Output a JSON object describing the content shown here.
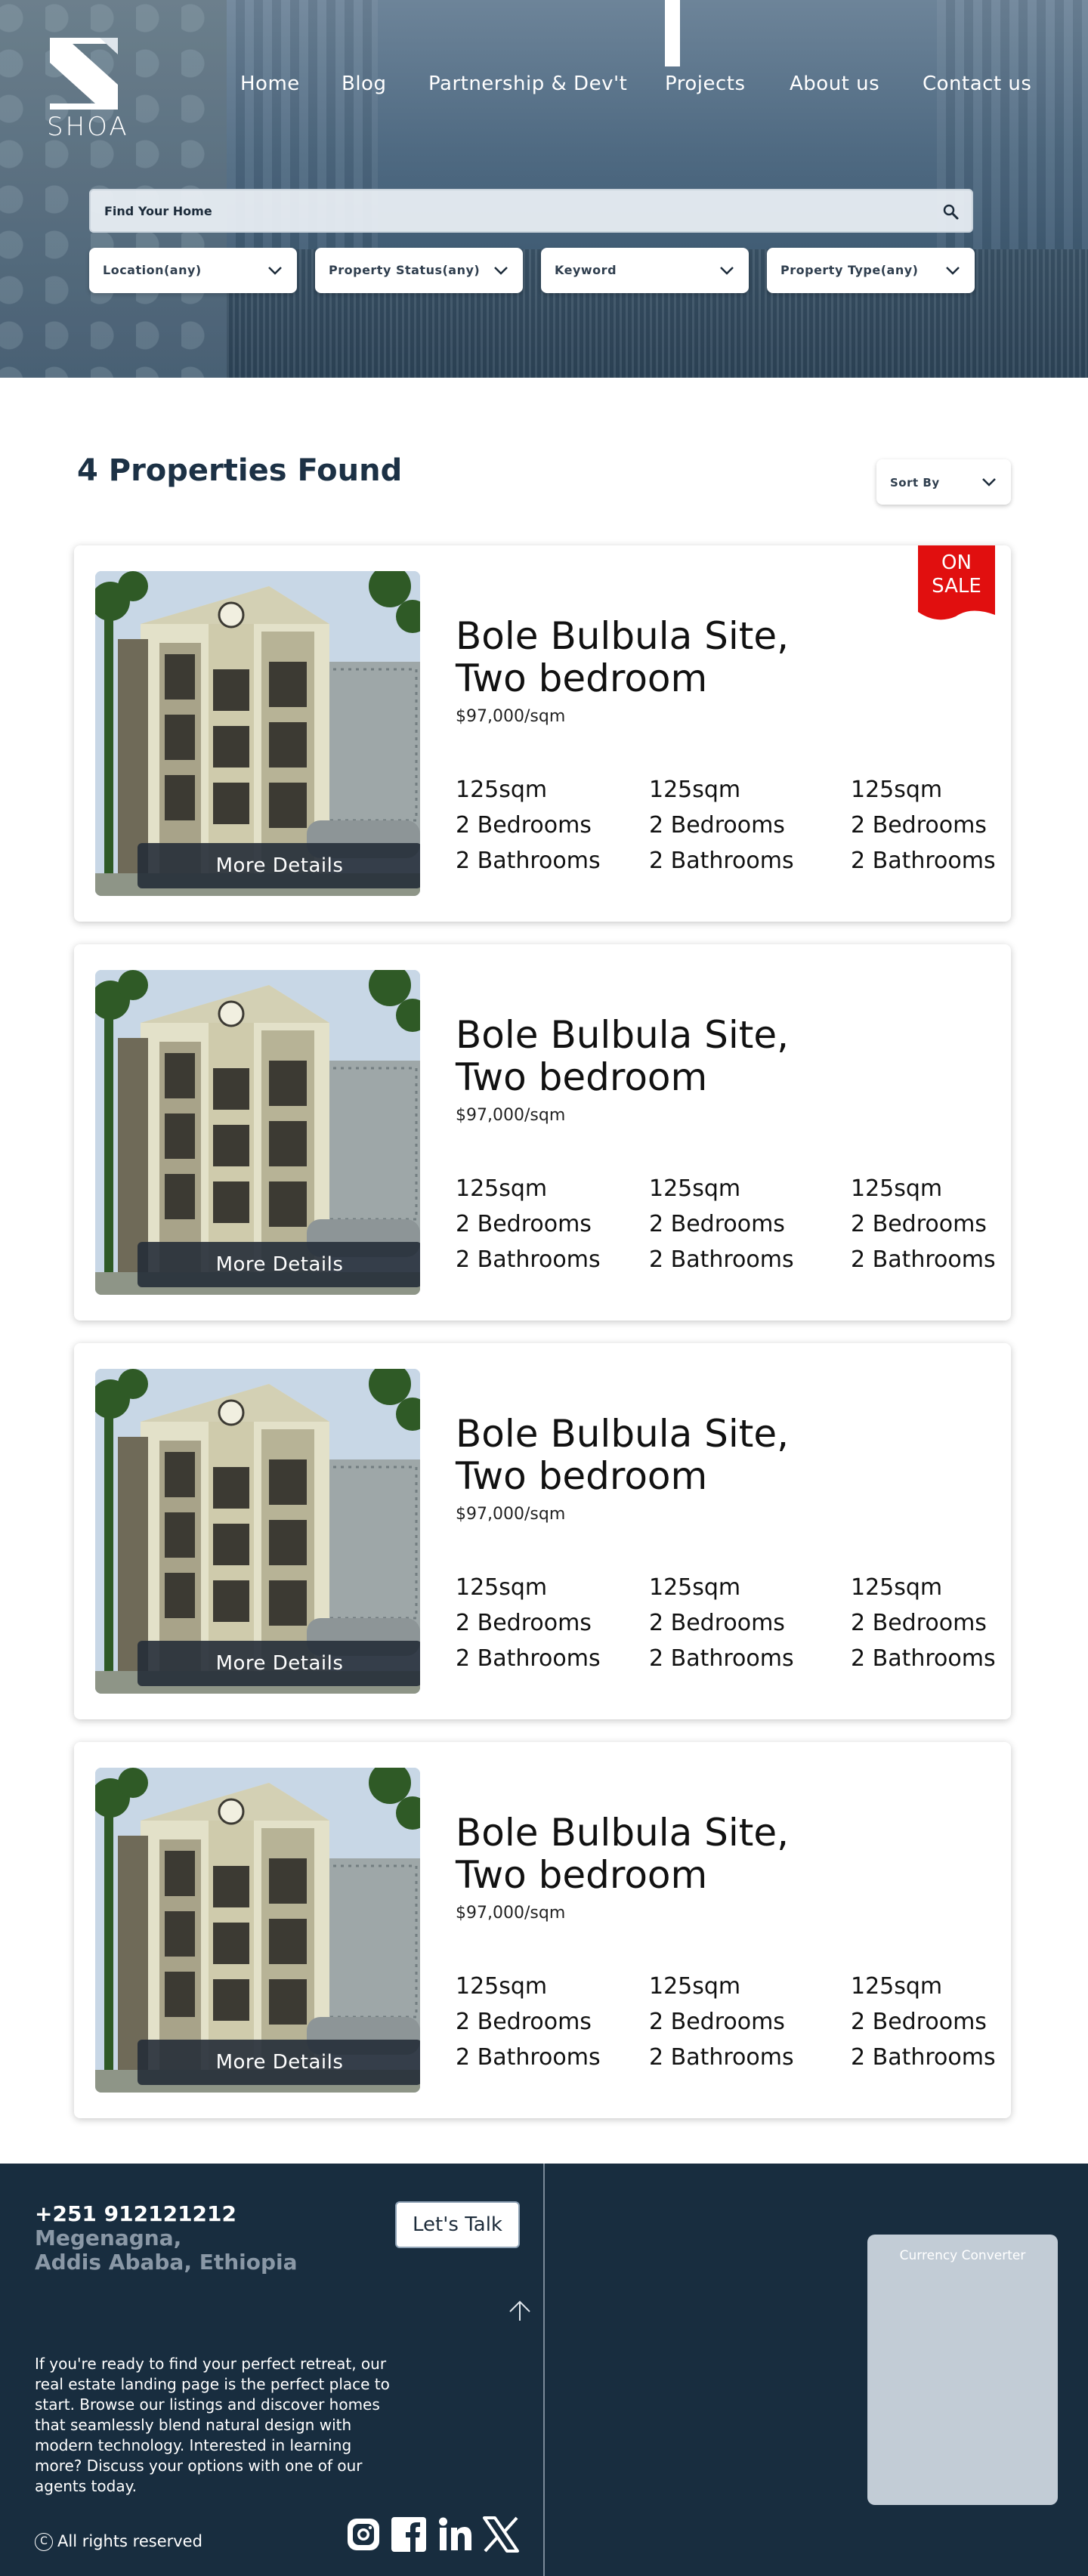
{
  "brand": {
    "logo_text": "SHOA"
  },
  "nav": {
    "items": [
      "Home",
      "Blog",
      "Partnership & Dev't",
      "Projects",
      "About us",
      "Contact us"
    ]
  },
  "search": {
    "placeholder": "Find Your Home",
    "filters": [
      "Location(any)",
      "Property Status(any)",
      "Keyword",
      "Property Type(any)"
    ]
  },
  "results": {
    "count_label": "4 Properties Found",
    "sort_label": "Sort By"
  },
  "listings": [
    {
      "badge": "ON SALE",
      "title_line1": "Bole Bulbula Site,",
      "title_line2": "Two bedroom",
      "price": "$97,000/sqm",
      "cta": "More Details",
      "columns": [
        {
          "area": "125sqm",
          "bedrooms": "2 Bedrooms",
          "bathrooms": "2 Bathrooms"
        },
        {
          "area": "125sqm",
          "bedrooms": "2 Bedrooms",
          "bathrooms": "2 Bathrooms"
        },
        {
          "area": "125sqm",
          "bedrooms": "2 Bedrooms",
          "bathrooms": "2 Bathrooms"
        }
      ]
    },
    {
      "title_line1": "Bole Bulbula Site,",
      "title_line2": "Two bedroom",
      "price": "$97,000/sqm",
      "cta": "More Details",
      "columns": [
        {
          "area": "125sqm",
          "bedrooms": "2 Bedrooms",
          "bathrooms": "2 Bathrooms"
        },
        {
          "area": "125sqm",
          "bedrooms": "2 Bedrooms",
          "bathrooms": "2 Bathrooms"
        },
        {
          "area": "125sqm",
          "bedrooms": "2 Bedrooms",
          "bathrooms": "2 Bathrooms"
        }
      ]
    },
    {
      "title_line1": "Bole Bulbula Site,",
      "title_line2": "Two bedroom",
      "price": "$97,000/sqm",
      "cta": "More Details",
      "columns": [
        {
          "area": "125sqm",
          "bedrooms": "2 Bedrooms",
          "bathrooms": "2 Bathrooms"
        },
        {
          "area": "125sqm",
          "bedrooms": "2 Bedrooms",
          "bathrooms": "2 Bathrooms"
        },
        {
          "area": "125sqm",
          "bedrooms": "2 Bedrooms",
          "bathrooms": "2 Bathrooms"
        }
      ]
    },
    {
      "title_line1": "Bole Bulbula Site,",
      "title_line2": "Two bedroom",
      "price": "$97,000/sqm",
      "cta": "More Details",
      "columns": [
        {
          "area": "125sqm",
          "bedrooms": "2 Bedrooms",
          "bathrooms": "2 Bathrooms"
        },
        {
          "area": "125sqm",
          "bedrooms": "2 Bedrooms",
          "bathrooms": "2 Bathrooms"
        },
        {
          "area": "125sqm",
          "bedrooms": "2 Bedrooms",
          "bathrooms": "2 Bathrooms"
        }
      ]
    }
  ],
  "footer": {
    "phone": "+251 912121212",
    "address_line1": "Megenagna,",
    "address_line2": "Addis Ababa, Ethiopia",
    "cta": "Let's Talk",
    "blurb": "If you're ready to find your perfect retreat, our real estate landing page is the perfect place to start. Browse our listings and discover homes that seamlessly blend natural design with modern technology. Interested in learning more? Discuss your options with one of our agents today.",
    "copyright_symbol": "C",
    "rights": "All rights reserved",
    "social_icons": [
      "instagram-icon",
      "facebook-icon",
      "linkedin-icon",
      "x-icon"
    ],
    "converter_title": "Currency Converter"
  },
  "colors": {
    "navy": "#182d3f",
    "heading": "#1c3145",
    "sale_red": "#e10f0f",
    "muted_address": "#8a98a6"
  }
}
